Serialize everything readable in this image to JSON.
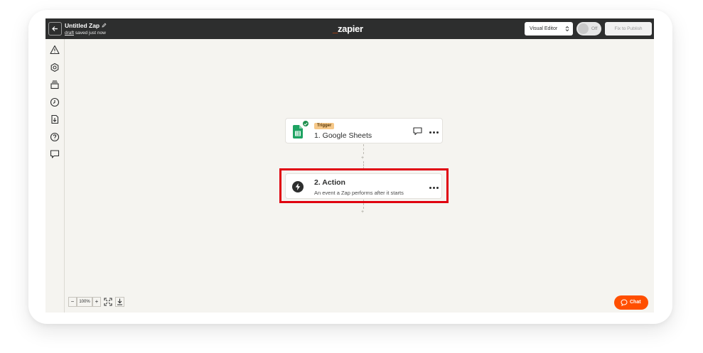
{
  "header": {
    "back_icon": "arrow-left-icon",
    "zap_title": "Untitled Zap",
    "edit_icon": "pencil-icon",
    "draft_label": "draft",
    "saved_status": "saved just now",
    "logo_prefix": "_",
    "logo_text": "zapier",
    "editor_select": "Visual Editor",
    "toggle_label": "Off",
    "toggle_on": false,
    "publish_button": "Fix to Publish"
  },
  "sidebar": {
    "icons": [
      "warning-icon",
      "gear-icon",
      "versions-icon",
      "history-icon",
      "export-icon",
      "help-icon",
      "comment-icon"
    ]
  },
  "steps": {
    "trigger": {
      "tag": "Trigger",
      "title": "1. Google Sheets",
      "app_icon": "google-sheets-icon",
      "status_icon": "check-icon"
    },
    "action": {
      "title": "2. Action",
      "description": "An event a Zap performs after it starts",
      "app_icon": "bolt-icon"
    }
  },
  "canvas": {
    "add_step_symbol": "+"
  },
  "zoom": {
    "minus": "−",
    "level": "100%",
    "plus": "+"
  },
  "chat": {
    "label": "Chat"
  },
  "colors": {
    "brand": "#ff4f00",
    "topbar": "#2d2e2e",
    "highlight": "#e0000f",
    "trigger_tag": "#f6c889"
  }
}
